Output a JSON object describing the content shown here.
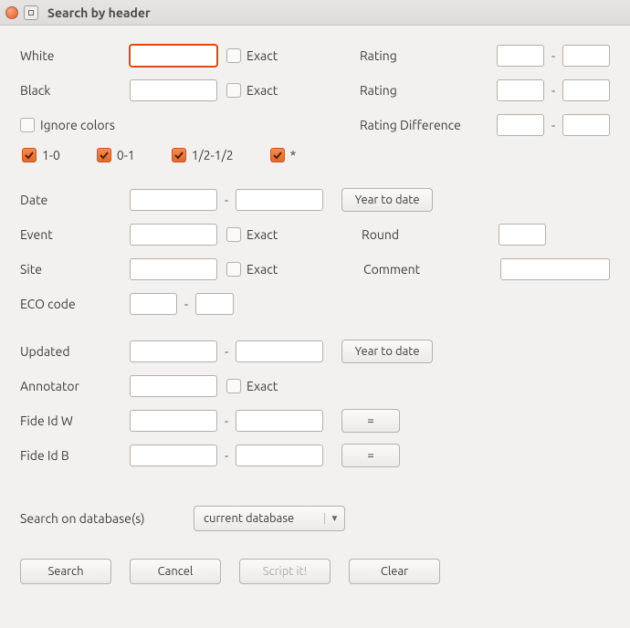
{
  "window": {
    "title": "Search by header"
  },
  "labels": {
    "white": "White",
    "black": "Black",
    "ignore_colors": "Ignore colors",
    "rating": "Rating",
    "rating_diff": "Rating Difference",
    "exact": "Exact",
    "date": "Date",
    "event": "Event",
    "site": "Site",
    "eco": "ECO code",
    "updated": "Updated",
    "annotator": "Annotator",
    "fide_w": "Fide Id W",
    "fide_b": "Fide Id B",
    "round": "Round",
    "comment": "Comment",
    "search_on_db": "Search on database(s)",
    "dash": "-"
  },
  "results": {
    "r10": "1-0",
    "r01": "0-1",
    "draw": "1/2-1/2",
    "star": "*"
  },
  "buttons": {
    "year_to_date": "Year to date",
    "eq": "=",
    "search": "Search",
    "cancel": "Cancel",
    "script": "Script it!",
    "clear": "Clear"
  },
  "select": {
    "database": "current database"
  },
  "values": {
    "white": "",
    "black": "",
    "white_rating_lo": "",
    "white_rating_hi": "",
    "black_rating_lo": "",
    "black_rating_hi": "",
    "rating_diff_lo": "",
    "rating_diff_hi": "",
    "date_lo": "",
    "date_hi": "",
    "event": "",
    "site": "",
    "round": "",
    "comment": "",
    "eco_lo": "",
    "eco_hi": "",
    "updated_lo": "",
    "updated_hi": "",
    "annotator": "",
    "fide_w_lo": "",
    "fide_w_hi": "",
    "fide_b_lo": "",
    "fide_b_hi": ""
  }
}
